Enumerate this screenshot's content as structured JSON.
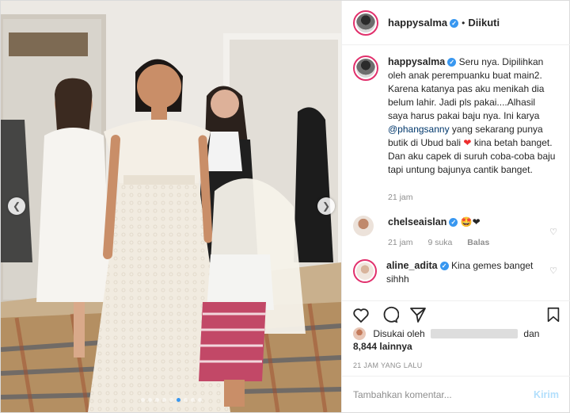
{
  "header": {
    "username": "happysalma",
    "separator": "•",
    "follow_status": "Diikuti"
  },
  "caption": {
    "username": "happysalma",
    "text_before_link": "Seru nya. Dipilihkan oleh anak perempuanku buat main2. Karena katanya pas aku menikah dia belum lahir. Jadi pls pakai....Alhasil saya harus pakai baju nya. Ini karya",
    "mention": "@phangsanny",
    "text_after_link": "yang sekarang punya butik di Ubud bali",
    "heart": "❤",
    "text_end": "kina betah banget. Dan aku capek di suruh coba-coba baju tapi untung bajunya cantik banget.",
    "time": "21 jam"
  },
  "comments": [
    {
      "username": "chelseaislan",
      "text": "🤩❤",
      "time": "21 jam",
      "likes": "9 suka",
      "reply": "Balas"
    },
    {
      "username": "aline_adita",
      "text": "Kina gemes banget sihhh",
      "time": "",
      "likes": "",
      "reply": ""
    }
  ],
  "likes": {
    "prefix": "Disukai oleh",
    "joiner": "dan",
    "count": "8,844 lainnya"
  },
  "timestamp": "21 JAM YANG LALU",
  "comment_box": {
    "placeholder": "Tambahkan komentar...",
    "submit": "Kirim"
  },
  "carousel": {
    "total": 9,
    "active_index": 5
  },
  "icons": {
    "prev": "chevron-left-icon",
    "next": "chevron-right-icon",
    "like": "heart-icon",
    "comment": "comment-icon",
    "share": "share-icon",
    "save": "bookmark-icon"
  },
  "colors": {
    "accent": "#3897f0",
    "story_ring": "#e1306c",
    "mention": "#00376b",
    "muted": "#8e8e8e",
    "submit_disabled": "#b2dffc"
  }
}
